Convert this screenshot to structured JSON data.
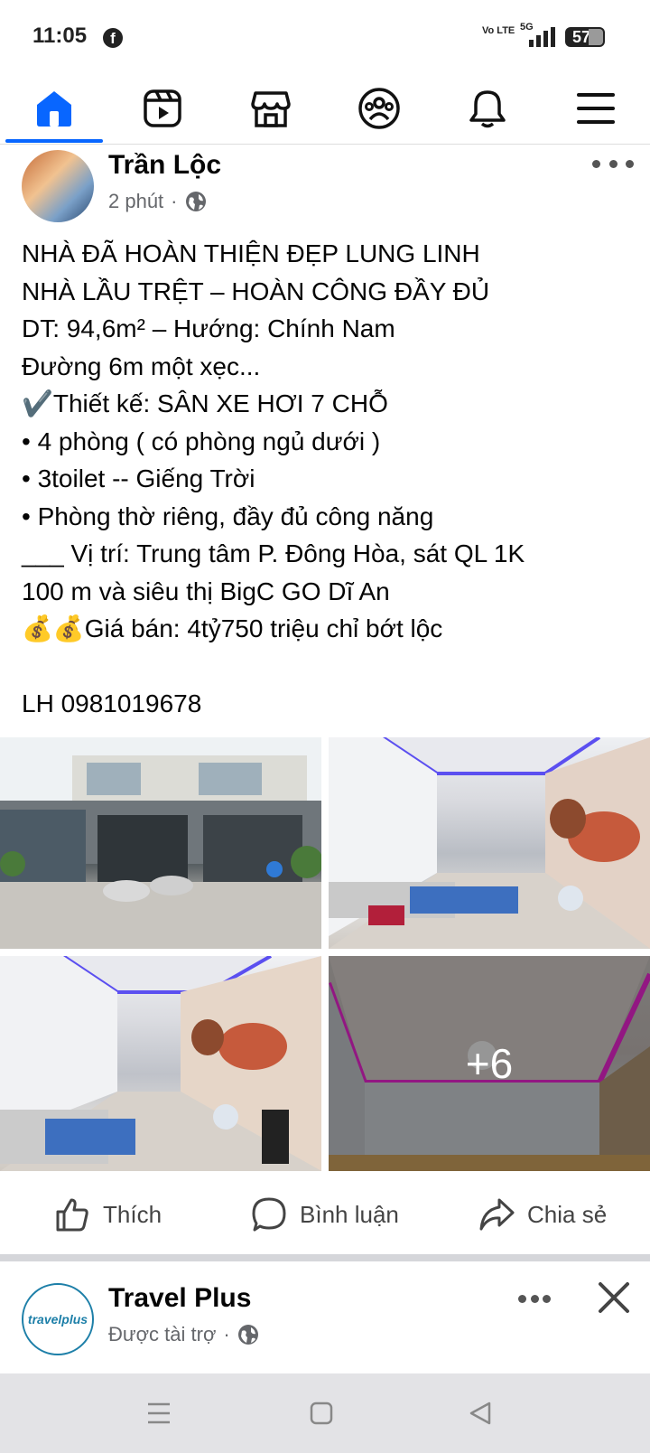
{
  "status_bar": {
    "time": "11:05",
    "app_icon": "facebook-icon",
    "volte": "Vo LTE",
    "network": "5G",
    "battery": "57"
  },
  "nav": {
    "tabs": [
      "home-icon",
      "reels-icon",
      "marketplace-icon",
      "groups-icon",
      "notifications-icon",
      "menu-icon"
    ],
    "active_tab": "home-icon",
    "accent": "#0866ff"
  },
  "post": {
    "author": "Trần Lộc",
    "time": "2 phút",
    "separator": "·",
    "privacy_icon": "globe-icon",
    "lines": [
      "NHÀ ĐÃ HOÀN THIỆN ĐẸP LUNG LINH",
      "NHÀ LẦU TRỆT – HOÀN CÔNG ĐẦY ĐỦ",
      "DT: 94,6m² – Hướng: Chính Nam",
      "Đường 6m một xẹc...",
      "✔️Thiết kế: SÂN XE HƠI 7 CHỖ",
      "• 4 phòng ( có phòng ngủ dưới )",
      "• 3toilet -- Giếng Trời",
      "• Phòng thờ riêng, đầy đủ công năng",
      "___ Vị trí: Trung tâm P. Đông Hòa, sát QL 1K",
      "100 m và siêu thị BigC GO Dĩ An",
      "💰💰Giá bán: 4tỷ750 triệu chỉ bớt lộc"
    ],
    "contact": "LH 0981019678",
    "more_photos": "+6"
  },
  "actions": {
    "like": "Thích",
    "comment": "Bình luận",
    "share": "Chia sẻ"
  },
  "sponsored_post": {
    "author": "Travel Plus",
    "avatar_text": "travelplus",
    "label": "Được tài trợ",
    "separator": "·"
  },
  "system_nav": [
    "recent-apps-icon",
    "home-button-icon",
    "back-icon"
  ]
}
